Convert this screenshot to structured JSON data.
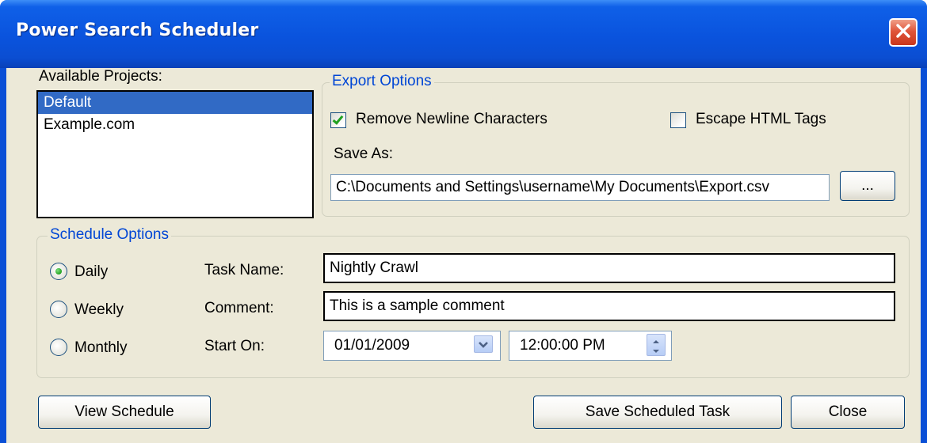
{
  "window": {
    "title": "Power Search Scheduler"
  },
  "projects": {
    "label": "Available Projects:",
    "items": [
      "Default",
      "Example.com"
    ],
    "selected": "Default"
  },
  "export_options": {
    "legend": "Export Options",
    "remove_newline": {
      "label": "Remove Newline Characters",
      "checked": true
    },
    "escape_html": {
      "label": "Escape HTML Tags",
      "checked": false
    },
    "save_as_label": "Save As:",
    "save_as_value": "C:\\Documents and Settings\\username\\My Documents\\Export.csv",
    "browse_label": "..."
  },
  "schedule_options": {
    "legend": "Schedule Options",
    "frequency": [
      {
        "label": "Daily",
        "selected": true
      },
      {
        "label": "Weekly",
        "selected": false
      },
      {
        "label": "Monthly",
        "selected": false
      }
    ],
    "task_name_label": "Task Name:",
    "task_name_value": "Nightly Crawl",
    "comment_label": "Comment:",
    "comment_value": "This is a sample comment",
    "start_on_label": "Start On:",
    "start_date": "01/01/2009",
    "start_time": "12:00:00 PM"
  },
  "buttons": {
    "view_schedule": "View Schedule",
    "save_task": "Save Scheduled Task",
    "close": "Close"
  },
  "colors": {
    "title_bar": "#0a53dd",
    "selection": "#316ac5",
    "group_legend": "#0046d5",
    "dialog_bg": "#ece9d8",
    "close_button": "#e0553a"
  }
}
